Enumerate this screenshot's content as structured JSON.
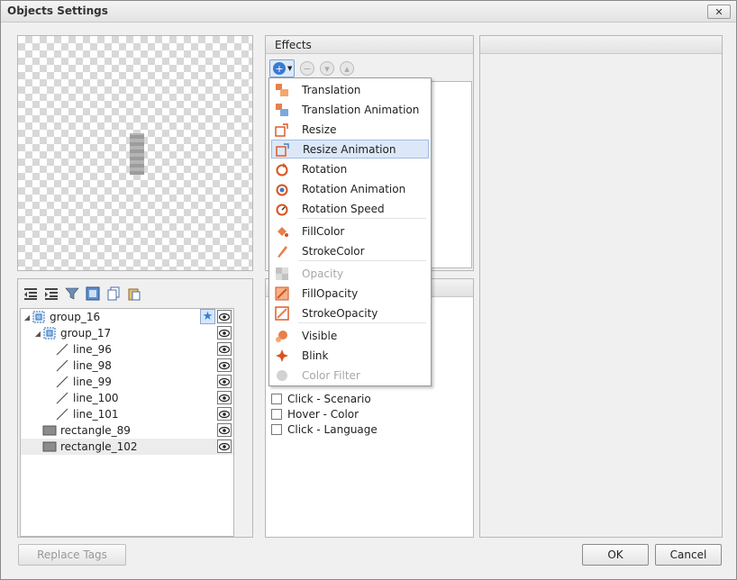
{
  "window": {
    "title": "Objects Settings",
    "close_glyph": "✕"
  },
  "effects": {
    "header": "Effects",
    "menu": [
      {
        "label": "Translation",
        "icon": "translation-icon"
      },
      {
        "label": "Translation Animation",
        "icon": "translation-animation-icon"
      },
      {
        "label": "Resize",
        "icon": "resize-icon"
      },
      {
        "label": "Resize Animation",
        "icon": "resize-animation-icon",
        "highlighted": true
      },
      {
        "label": "Rotation",
        "icon": "rotation-icon"
      },
      {
        "label": "Rotation Animation",
        "icon": "rotation-animation-icon"
      },
      {
        "label": "Rotation Speed",
        "icon": "rotation-speed-icon"
      },
      {
        "label": "FillColor",
        "icon": "fill-color-icon"
      },
      {
        "label": "StrokeColor",
        "icon": "stroke-color-icon"
      },
      {
        "label": "Opacity",
        "icon": "opacity-icon",
        "disabled": true
      },
      {
        "label": "FillOpacity",
        "icon": "fill-opacity-icon"
      },
      {
        "label": "StrokeOpacity",
        "icon": "stroke-opacity-icon"
      },
      {
        "label": "Visible",
        "icon": "visible-icon"
      },
      {
        "label": "Blink",
        "icon": "blink-icon"
      },
      {
        "label": "Color Filter",
        "icon": "color-filter-icon",
        "disabled": true
      }
    ]
  },
  "tree": {
    "items": [
      {
        "label": "group_16",
        "type": "group",
        "level": 0,
        "expanded": true
      },
      {
        "label": "group_17",
        "type": "group",
        "level": 1,
        "expanded": true
      },
      {
        "label": "line_96",
        "type": "line",
        "level": 2
      },
      {
        "label": "line_98",
        "type": "line",
        "level": 2
      },
      {
        "label": "line_99",
        "type": "line",
        "level": 2
      },
      {
        "label": "line_100",
        "type": "line",
        "level": 2
      },
      {
        "label": "line_101",
        "type": "line",
        "level": 2
      },
      {
        "label": "rectangle_89",
        "type": "rectangle",
        "level": 1
      },
      {
        "label": "rectangle_102",
        "type": "rectangle",
        "level": 1,
        "selected": true
      }
    ]
  },
  "events": {
    "items": [
      {
        "label": "Click - Scenario"
      },
      {
        "label": "Hover - Color"
      },
      {
        "label": "Click - Language"
      }
    ]
  },
  "buttons": {
    "replace_tags": "Replace Tags",
    "ok": "OK",
    "cancel": "Cancel"
  }
}
